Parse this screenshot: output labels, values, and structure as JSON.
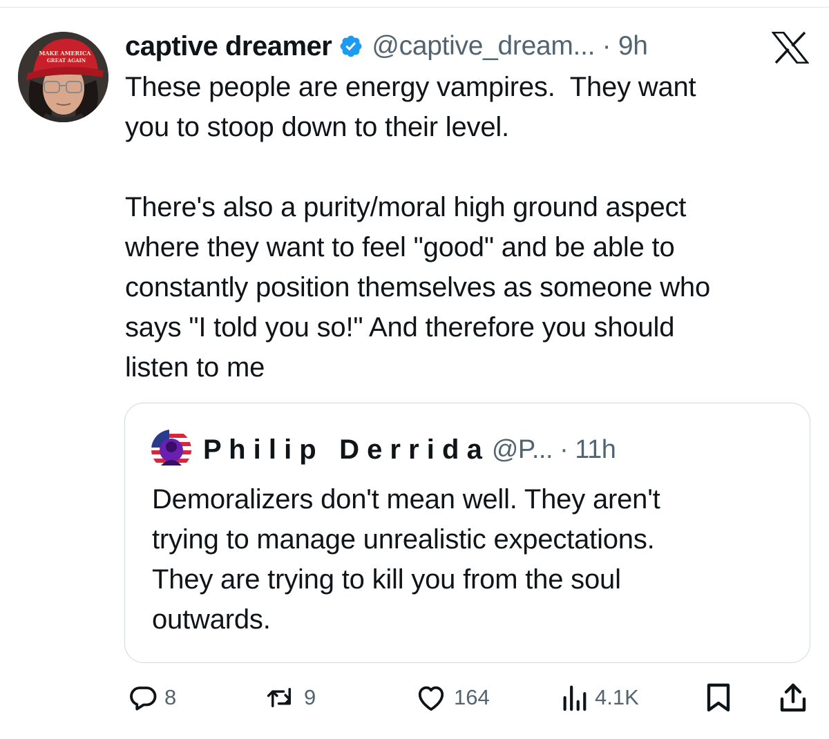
{
  "author": {
    "display_name": "captive dreamer",
    "handle_time": "@captive_dream... · 9h",
    "hat_text": "MAKE AMERICA GREAT AGAIN"
  },
  "tweet": {
    "text": "These people are energy vampires.  They want\nyou to stoop down to their level.\n\nThere's also a purity/moral high ground aspect\nwhere they want to feel \"good\" and be able to\nconstantly position themselves as someone who\nsays \"I told you so!\" And therefore you should\nlisten to me"
  },
  "quoted_tweet": {
    "display_name": "P h i l i p   D e r r i d a",
    "handle_time": "@P... · 11h",
    "text": "Demoralizers don't mean well. They aren't\ntrying to manage unrealistic expectations.\nThey are trying to kill you from the soul\noutwards."
  },
  "actions": {
    "replies": "8",
    "reposts": "9",
    "likes": "164",
    "views": "4.1K"
  },
  "icons": {
    "verified": "verified-badge-icon",
    "platform": "x-logo-icon",
    "reply": "reply-icon",
    "repost": "repost-icon",
    "like": "heart-icon",
    "views": "views-chart-icon",
    "bookmark": "bookmark-icon",
    "share": "share-icon"
  },
  "colors": {
    "text": "#0f1419",
    "secondary": "#536471",
    "verified": "#1d9bf0",
    "border": "#cfd9de",
    "hat_red": "#c8202a"
  }
}
